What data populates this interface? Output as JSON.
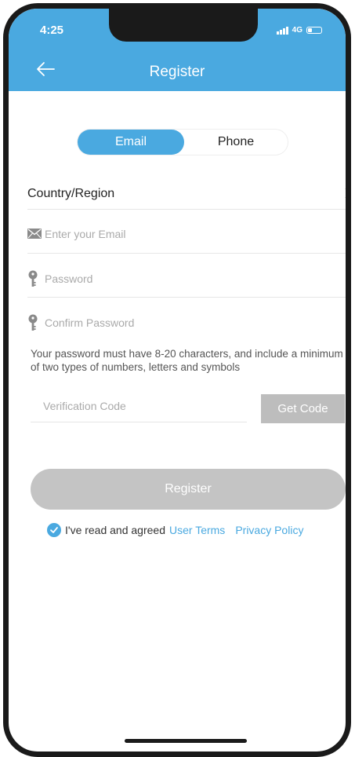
{
  "status_bar": {
    "time": "4:25",
    "network": "4G"
  },
  "header": {
    "title": "Register",
    "color": "#4aa9e0"
  },
  "tabs": {
    "email_label": "Email",
    "phone_label": "Phone",
    "selected": "Email"
  },
  "form": {
    "country_label": "Country/Region",
    "email_placeholder": "Enter your Email",
    "password_placeholder": "Password",
    "confirm_placeholder": "Confirm Password",
    "hint": "Your password must have 8-20 characters, and include a minimum of two types of numbers, letters and symbols",
    "code_placeholder": "Verification Code",
    "get_code_label": "Get Code",
    "register_label": "Register"
  },
  "agreement": {
    "checked": true,
    "text": "I've read and agreed",
    "user_terms": "User Terms",
    "privacy_policy": "Privacy Policy"
  },
  "icons": {
    "back": "arrow-left-icon",
    "country_chevron": "chevron-right-icon",
    "email": "envelope-icon",
    "password": "key-icon",
    "confirm": "key-icon",
    "check": "check-circle-icon"
  }
}
